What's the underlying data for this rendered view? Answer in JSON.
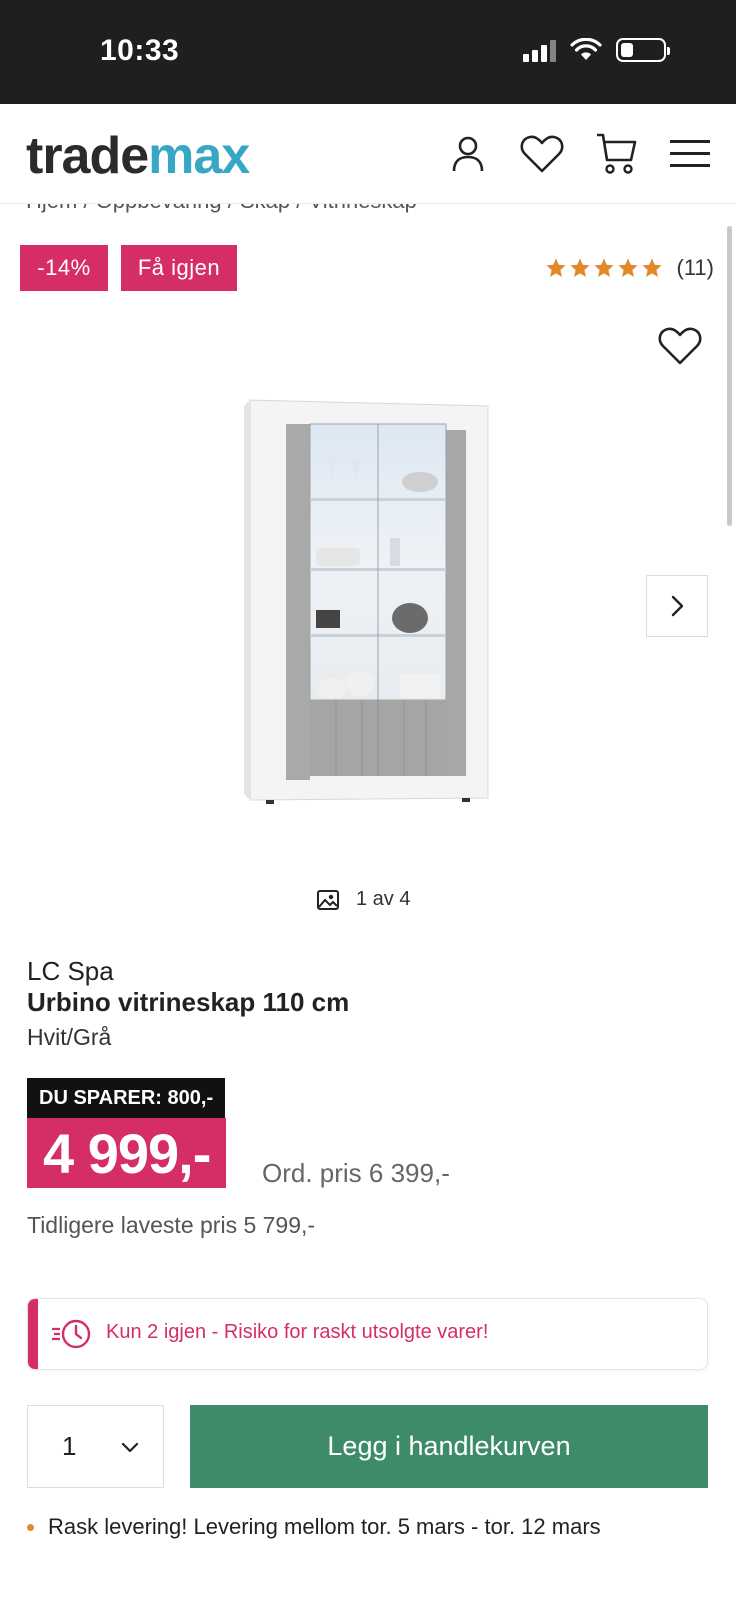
{
  "status_bar": {
    "time": "10:33"
  },
  "header": {
    "logo_part1": "trade",
    "logo_part2": "max",
    "brand_color": "#37a7c3",
    "icons": [
      "user-icon",
      "heart-icon",
      "cart-icon",
      "menu-icon"
    ]
  },
  "breadcrumb": "Hjem  /  Oppbevaring  /  Skap  /  Vitrineskap",
  "badges": {
    "discount": "-14%",
    "few_left": "Få igjen"
  },
  "rating": {
    "stars": 5,
    "count": "(11)"
  },
  "gallery": {
    "counter": "1 av 4"
  },
  "product": {
    "brand": "LC Spa",
    "name": "Urbino vitrineskap 110 cm",
    "variant": "Hvit/Grå"
  },
  "pricing": {
    "savings": "DU SPARER: 800,-",
    "price": "4 999,-",
    "ordinary": "Ord. pris 6 399,-",
    "lowest": "Tidligere laveste pris 5 799,-"
  },
  "stock_alert": {
    "text": "Kun 2 igjen - Risiko for raskt utsolgte varer!"
  },
  "cart": {
    "quantity": "1",
    "add_label": "Legg i handlekurven"
  },
  "delivery": {
    "text": "Rask levering! Levering mellom tor. 5 mars - tor. 12 mars"
  },
  "colors": {
    "accent_pink": "#d52d68",
    "button_green": "#3d8b69",
    "star_orange": "#e08a2c"
  }
}
